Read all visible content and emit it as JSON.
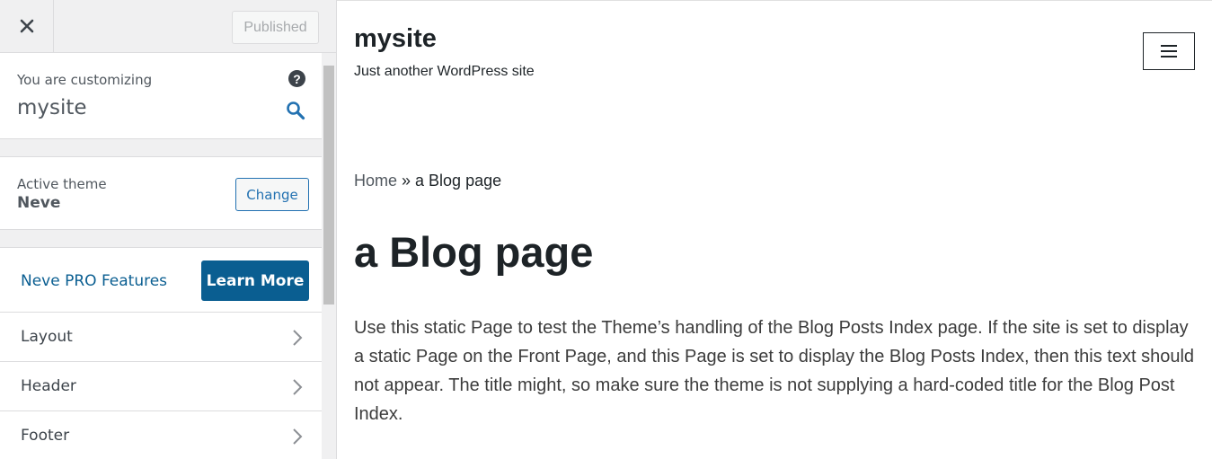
{
  "sidebar": {
    "close_icon": "close-icon",
    "publish_label": "Published",
    "customizing_label": "You are customizing",
    "site_name": "mysite",
    "help_icon": "help-icon",
    "help_glyph": "?",
    "search_icon": "search-icon",
    "active_theme_label": "Active theme",
    "theme_name": "Neve",
    "change_label": "Change",
    "pro_label": "Neve PRO Features",
    "learn_more_label": "Learn More",
    "menu_items": [
      {
        "label": "Layout",
        "icon": "chevron-right-icon"
      },
      {
        "label": "Header",
        "icon": "chevron-right-icon"
      },
      {
        "label": "Footer",
        "icon": "chevron-right-icon"
      }
    ],
    "colors": {
      "accent": "#0a5e91",
      "link": "#2271b1",
      "background": "#f0f0f1"
    }
  },
  "preview": {
    "site_title": "mysite",
    "tagline": "Just another WordPress site",
    "menu_icon": "hamburger-menu-icon",
    "breadcrumb": {
      "home": "Home",
      "separator": " » ",
      "current": "a Blog page"
    },
    "page_title": "a Blog page",
    "body": "Use this static Page to test the Theme’s handling of the Blog Posts Index page. If the site is set to display a static Page on the Front Page, and this Page is set to display the Blog Posts Index, then this text should not appear. The title might, so make sure the theme is not supplying a hard-coded title for the Blog Post Index."
  }
}
